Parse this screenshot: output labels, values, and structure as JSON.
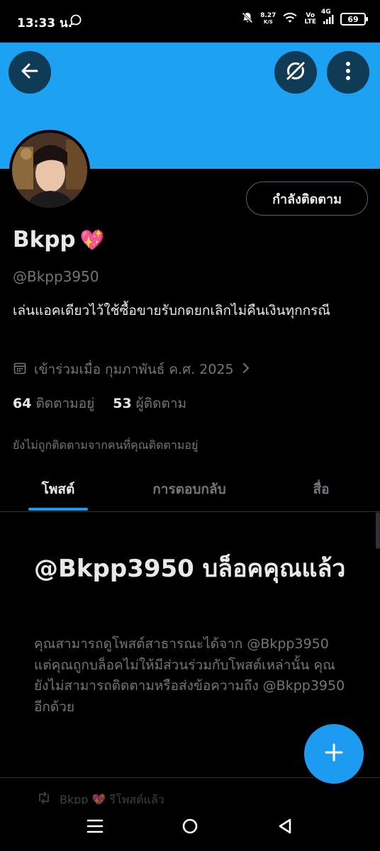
{
  "status_bar": {
    "time": "13:33 น.",
    "net_speed": "8.27",
    "net_speed_unit": "K/S",
    "volte_top": "Vo",
    "volte_bottom": "LTE",
    "network": "4G",
    "battery": "69"
  },
  "header": {
    "banner_color": "#1da1f2",
    "back_icon": "arrow-left-icon",
    "grok_icon": "grok-icon",
    "more_icon": "more-vertical-icon"
  },
  "profile": {
    "display_name": "Bkpp",
    "name_emoji": "💖",
    "handle": "@Bkpp3950",
    "bio": "เล่นแอคเดียวไว้ใช้ซื้อขายรับกดยกเลิกไม่คืนเงินทุกกรณี",
    "joined": "เข้าร่วมเมื่อ กุมภาพันธ์ ค.ศ. 2025",
    "following_count": "64",
    "following_label": "ติดตามอยู่",
    "followers_count": "53",
    "followers_label": "ผู้ติดตาม",
    "not_followed_text": "ยังไม่ถูกติดตามจากคนที่คุณติดตามอยู่",
    "follow_button_label": "กำลังติดตาม"
  },
  "tabs": [
    {
      "label": "โพสต์",
      "active": true
    },
    {
      "label": "การตอบกลับ",
      "active": false
    },
    {
      "label": "สื่อ",
      "active": false
    }
  ],
  "blocked": {
    "title": "@Bkpp3950 บล็อคคุณแล้ว",
    "description": "คุณสามารถดูโพสต์สาธารณะได้จาก @Bkpp3950 แต่คุณถูกบล็อคไม่ให้มีส่วนร่วมกับโพสต์เหล่านั้น คุณยังไม่สามารถติดตามหรือส่งข้อความถึง @Bkpp3950 อีกด้วย"
  },
  "peek": {
    "text": "Bkpp 💖 รีโพสต์แล้ว"
  },
  "fab": {
    "icon": "plus-icon"
  },
  "colors": {
    "accent": "#1d9bf0",
    "secondary_text": "#71767b",
    "primary_text": "#e7e9ea",
    "background": "#000000"
  }
}
